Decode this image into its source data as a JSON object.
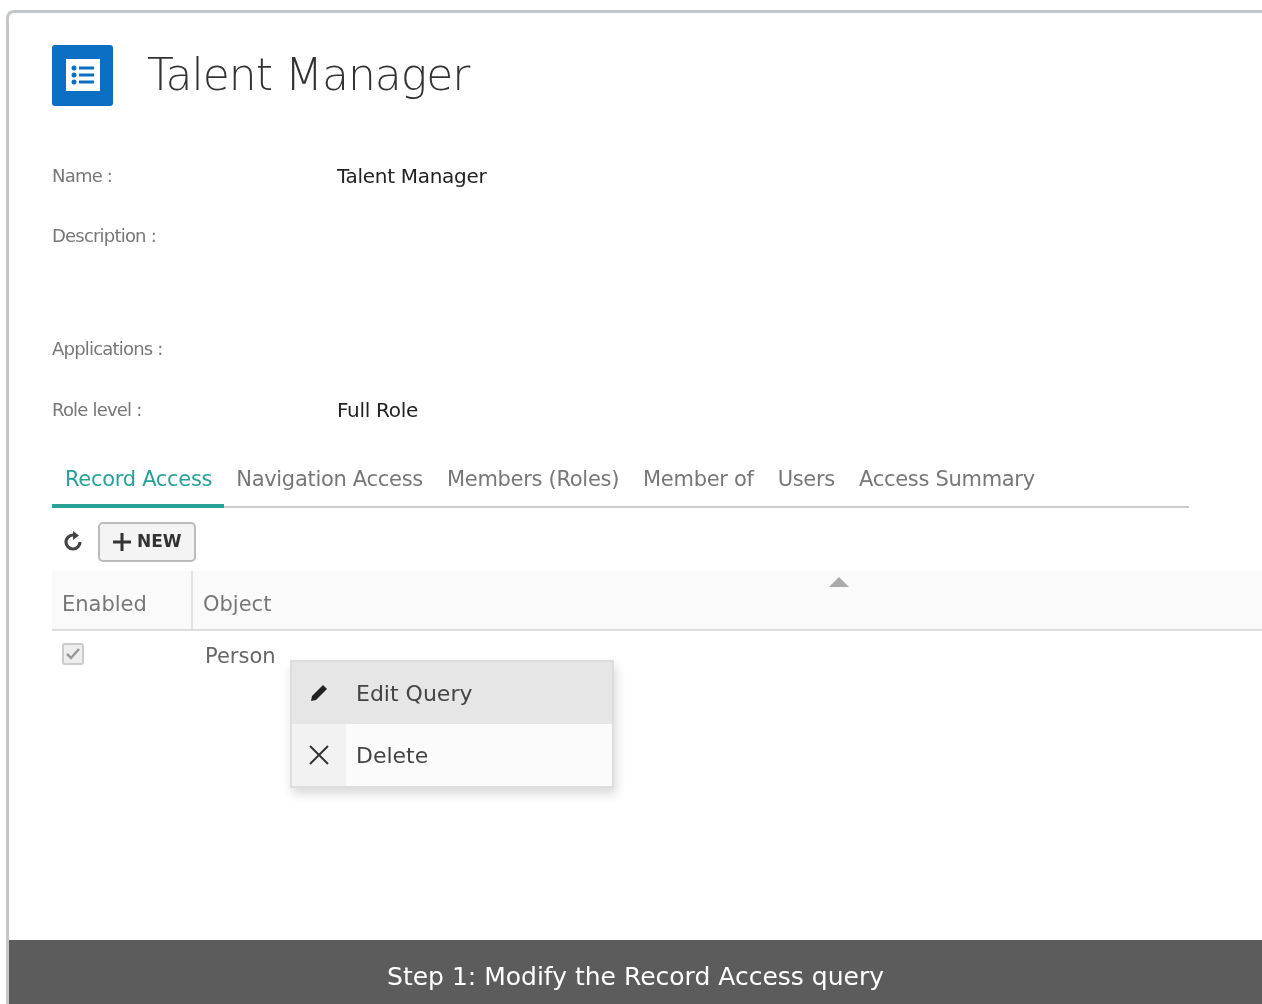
{
  "header": {
    "title": "Talent Manager"
  },
  "fields": [
    {
      "label": "Name :",
      "value": "Talent Manager"
    },
    {
      "label": "Description :"
    },
    {
      "label": "Applications :"
    },
    {
      "label": "Role level :",
      "value": "Full Role"
    }
  ],
  "tabs": [
    {
      "label": "Record Access",
      "selected": true
    },
    {
      "label": "Navigation Access",
      "selected": false
    },
    {
      "label": "Members (Roles)",
      "selected": false
    },
    {
      "label": "Member of",
      "selected": false
    },
    {
      "label": "Users",
      "selected": false
    },
    {
      "label": "Access Summary",
      "selected": false
    }
  ],
  "toolbar": {
    "new_button": "NEW"
  },
  "table": {
    "columns": [
      {
        "label": "Enabled",
        "sorted": false
      },
      {
        "label": "Object",
        "sorted": true
      }
    ],
    "rows": [
      {
        "enabled": true,
        "object": "Person"
      }
    ]
  },
  "context_menu": [
    {
      "kind": "edit",
      "label": "Edit Query",
      "selected": true
    },
    {
      "kind": "delete",
      "label": "Delete",
      "selected": false
    }
  ],
  "caption": "Step 1: Modify the Record Access query"
}
